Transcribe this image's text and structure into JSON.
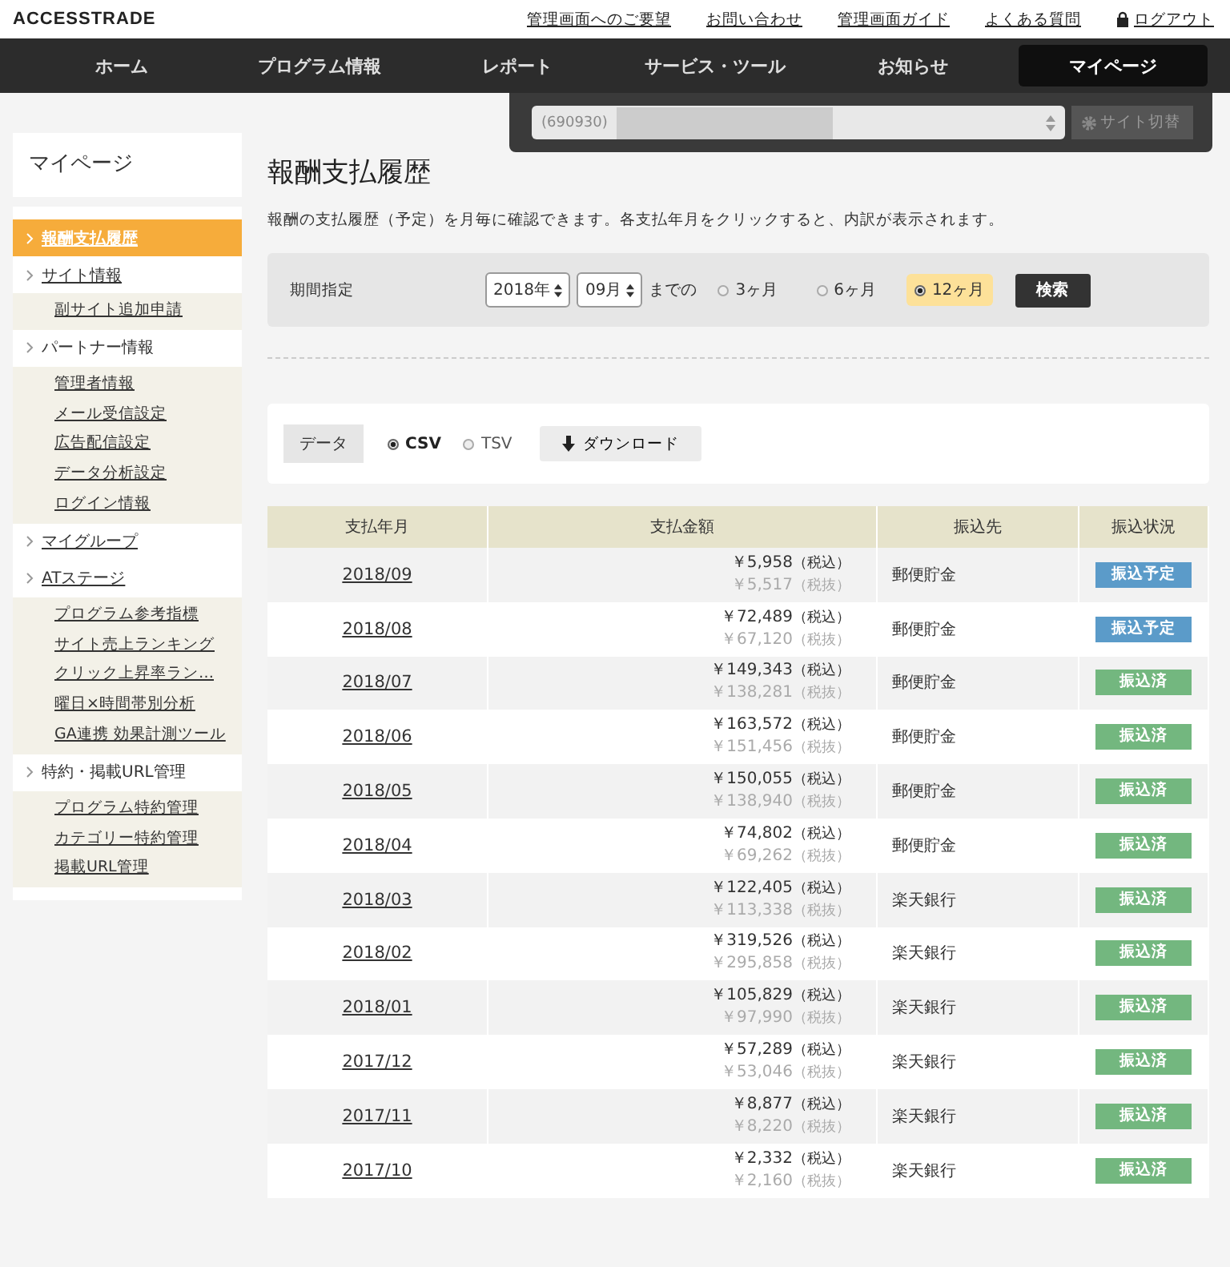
{
  "logo": "ACCESSTRADE",
  "top_links": [
    {
      "label": "管理画面へのご要望",
      "kind": "link"
    },
    {
      "label": "お問い合わせ",
      "kind": "link"
    },
    {
      "label": "管理画面ガイド",
      "kind": "link"
    },
    {
      "label": "よくある質問",
      "kind": "link"
    },
    {
      "label": "ログアウト",
      "kind": "logout"
    }
  ],
  "nav": [
    {
      "label": "ホーム",
      "selected": false
    },
    {
      "label": "プログラム情報",
      "selected": false
    },
    {
      "label": "レポート",
      "selected": false
    },
    {
      "label": "サービス・ツール",
      "selected": false
    },
    {
      "label": "お知らせ",
      "selected": false
    },
    {
      "label": "マイページ",
      "selected": true
    }
  ],
  "site_switcher": {
    "value": "(690930)",
    "button": "サイト切替"
  },
  "sidebar": {
    "title": "マイページ",
    "items": [
      {
        "label": "報酬支払履歴",
        "selected": true
      },
      {
        "label": "サイト情報",
        "selected": false,
        "children": [
          {
            "label": "副サイト追加申請"
          }
        ]
      },
      {
        "label": "パートナー情報",
        "selected": false,
        "children": [
          {
            "label": "管理者情報"
          },
          {
            "label": "メール受信設定"
          },
          {
            "label": "広告配信設定"
          },
          {
            "label": "データ分析設定"
          },
          {
            "label": "ログイン情報"
          }
        ]
      },
      {
        "label": "マイグループ",
        "selected": false
      },
      {
        "label": "ATステージ",
        "selected": false,
        "children": [
          {
            "label": "プログラム参考指標"
          },
          {
            "label": "サイト売上ランキング"
          },
          {
            "label": "クリック上昇率ラン…"
          },
          {
            "label": "曜日×時間帯別分析"
          },
          {
            "label": "GA連携 効果計測ツール"
          }
        ]
      },
      {
        "label": "特約・掲載URL管理",
        "selected": false,
        "children": [
          {
            "label": "プログラム特約管理"
          },
          {
            "label": "カテゴリー特約管理"
          },
          {
            "label": "掲載URL管理"
          }
        ]
      }
    ]
  },
  "page_title": "報酬支払履歴",
  "description": "報酬の支払履歴（予定）を月毎に確認できます。各支払年月をクリックすると、内訳が表示されます。",
  "filter": {
    "label": "期間指定",
    "year": "2018年",
    "month": "09月",
    "until": "までの",
    "periods": [
      {
        "label": "3ヶ月",
        "selected": false
      },
      {
        "label": "6ヶ月",
        "selected": false
      },
      {
        "label": "12ヶ月",
        "selected": true
      }
    ],
    "search_button": "検索"
  },
  "download": {
    "label": "データ",
    "formats": [
      {
        "label": "CSV",
        "selected": true
      },
      {
        "label": "TSV",
        "selected": false
      }
    ],
    "button": "ダウンロード"
  },
  "table": {
    "columns": [
      "支払年月",
      "支払金額",
      "振込先",
      "振込状況"
    ],
    "rows": [
      {
        "month": "2018/09",
        "gross": "￥5,958",
        "gross_note": "（税込）",
        "net": "￥5,517",
        "net_note": "（税抜）",
        "bank": "郵便貯金",
        "status": "振込予定",
        "color": "#5b9bc9"
      },
      {
        "month": "2018/08",
        "gross": "￥72,489",
        "gross_note": "（税込）",
        "net": "￥67,120",
        "net_note": "（税抜）",
        "bank": "郵便貯金",
        "status": "振込予定",
        "color": "#5b9bc9"
      },
      {
        "month": "2018/07",
        "gross": "￥149,343",
        "gross_note": "（税込）",
        "net": "￥138,281",
        "net_note": "（税抜）",
        "bank": "郵便貯金",
        "status": "振込済",
        "color": "#73b77f"
      },
      {
        "month": "2018/06",
        "gross": "￥163,572",
        "gross_note": "（税込）",
        "net": "￥151,456",
        "net_note": "（税抜）",
        "bank": "郵便貯金",
        "status": "振込済",
        "color": "#73b77f"
      },
      {
        "month": "2018/05",
        "gross": "￥150,055",
        "gross_note": "（税込）",
        "net": "￥138,940",
        "net_note": "（税抜）",
        "bank": "郵便貯金",
        "status": "振込済",
        "color": "#73b77f"
      },
      {
        "month": "2018/04",
        "gross": "￥74,802",
        "gross_note": "（税込）",
        "net": "￥69,262",
        "net_note": "（税抜）",
        "bank": "郵便貯金",
        "status": "振込済",
        "color": "#73b77f"
      },
      {
        "month": "2018/03",
        "gross": "￥122,405",
        "gross_note": "（税込）",
        "net": "￥113,338",
        "net_note": "（税抜）",
        "bank": "楽天銀行",
        "status": "振込済",
        "color": "#73b77f"
      },
      {
        "month": "2018/02",
        "gross": "￥319,526",
        "gross_note": "（税込）",
        "net": "￥295,858",
        "net_note": "（税抜）",
        "bank": "楽天銀行",
        "status": "振込済",
        "color": "#73b77f"
      },
      {
        "month": "2018/01",
        "gross": "￥105,829",
        "gross_note": "（税込）",
        "net": "￥97,990",
        "net_note": "（税抜）",
        "bank": "楽天銀行",
        "status": "振込済",
        "color": "#73b77f"
      },
      {
        "month": "2017/12",
        "gross": "￥57,289",
        "gross_note": "（税込）",
        "net": "￥53,046",
        "net_note": "（税抜）",
        "bank": "楽天銀行",
        "status": "振込済",
        "color": "#73b77f"
      },
      {
        "month": "2017/11",
        "gross": "￥8,877",
        "gross_note": "（税込）",
        "net": "￥8,220",
        "net_note": "（税抜）",
        "bank": "楽天銀行",
        "status": "振込済",
        "color": "#73b77f"
      },
      {
        "month": "2017/10",
        "gross": "￥2,332",
        "gross_note": "（税込）",
        "net": "￥2,160",
        "net_note": "（税抜）",
        "bank": "楽天銀行",
        "status": "振込済",
        "color": "#73b77f"
      }
    ]
  }
}
